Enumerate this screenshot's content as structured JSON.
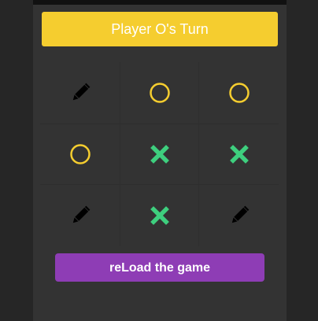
{
  "status": {
    "turn_label": "Player O's Turn",
    "color": "#f5cd2f"
  },
  "board": {
    "cells": [
      [
        "empty",
        "O",
        "O"
      ],
      [
        "O",
        "X",
        "X"
      ],
      [
        "empty",
        "X",
        "empty"
      ]
    ],
    "icons": {
      "empty": "pencil-icon",
      "O": "circle-o-icon",
      "X": "cross-x-icon"
    },
    "colors": {
      "O": "#f5cd2f",
      "X": "#3ecf7e",
      "empty": "#000000"
    }
  },
  "actions": {
    "reload_label": "reLoad the game",
    "reload_color": "#8e3db5"
  }
}
